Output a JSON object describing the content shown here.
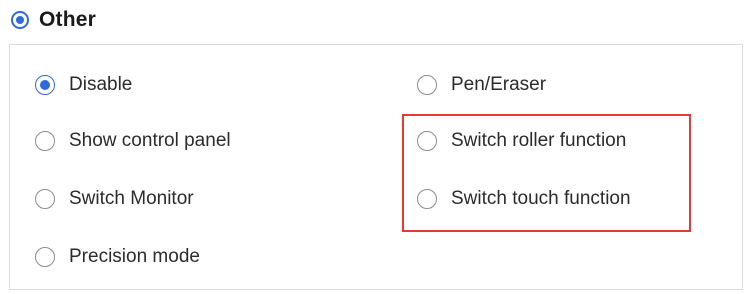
{
  "section": {
    "title": "Other",
    "selected": true
  },
  "options": {
    "disable": {
      "label": "Disable",
      "checked": true
    },
    "show_control_panel": {
      "label": "Show control panel",
      "checked": false
    },
    "switch_monitor": {
      "label": "Switch Monitor",
      "checked": false
    },
    "precision_mode": {
      "label": "Precision mode",
      "checked": false
    },
    "pen_eraser": {
      "label": "Pen/Eraser",
      "checked": false
    },
    "switch_roller_function": {
      "label": "Switch roller function",
      "checked": false
    },
    "switch_touch_function": {
      "label": "Switch touch function",
      "checked": false
    }
  },
  "colors": {
    "accent": "#2f6bd8",
    "highlight": "#e53935"
  }
}
